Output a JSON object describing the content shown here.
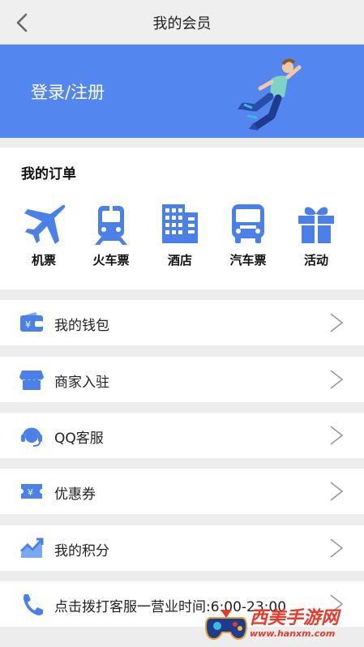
{
  "header": {
    "title": "我的会员"
  },
  "banner": {
    "login_label": "登录/注册"
  },
  "orders": {
    "title": "我的订单",
    "items": [
      {
        "label": "机票",
        "icon": "airplane-icon"
      },
      {
        "label": "火车票",
        "icon": "train-icon"
      },
      {
        "label": "酒店",
        "icon": "hotel-icon"
      },
      {
        "label": "汽车票",
        "icon": "bus-icon"
      },
      {
        "label": "活动",
        "icon": "gift-icon"
      }
    ]
  },
  "menu": [
    {
      "label": "我的钱包",
      "icon": "wallet-icon"
    },
    {
      "label": "商家入驻",
      "icon": "shop-icon"
    },
    {
      "label": "QQ客服",
      "icon": "headset-icon"
    },
    {
      "label": "优惠券",
      "icon": "coupon-icon"
    },
    {
      "label": "我的积分",
      "icon": "chart-icon"
    },
    {
      "label": "点击拨打客服一营业时间:6:00-23:00",
      "icon": "phone-icon"
    }
  ],
  "watermark": {
    "title": "西美手游网",
    "subtitle": "www.hanxm.com"
  },
  "colors": {
    "accent": "#5387ef",
    "icon_blue": "#4a80e8"
  }
}
